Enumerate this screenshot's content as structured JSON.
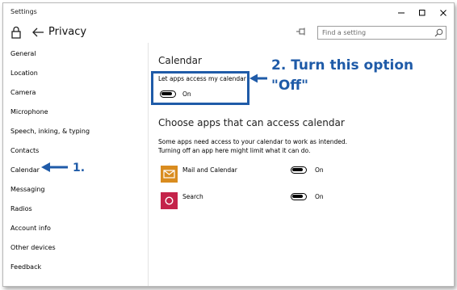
{
  "window": {
    "title": "Settings"
  },
  "header": {
    "page_title": "Privacy",
    "search_placeholder": "Find a setting"
  },
  "sidebar": {
    "items": [
      {
        "label": "General"
      },
      {
        "label": "Location"
      },
      {
        "label": "Camera"
      },
      {
        "label": "Microphone"
      },
      {
        "label": "Speech, inking, & typing"
      },
      {
        "label": "Contacts"
      },
      {
        "label": "Calendar"
      },
      {
        "label": "Messaging"
      },
      {
        "label": "Radios"
      },
      {
        "label": "Account info"
      },
      {
        "label": "Other devices"
      },
      {
        "label": "Feedback"
      }
    ],
    "selected": "Calendar"
  },
  "main": {
    "section_title": "Calendar",
    "access_label": "Let apps access my calendar",
    "access_state": "On",
    "choose_title": "Choose apps that can access calendar",
    "description_line1": "Some apps need access to your calendar to work as intended.",
    "description_line2": "Turning off an app here might limit what it can do.",
    "apps": [
      {
        "name": "Mail and Calendar",
        "state": "On",
        "icon": "mail-calendar-icon",
        "color": "#d98c1f"
      },
      {
        "name": "Search",
        "state": "On",
        "icon": "search-app-icon",
        "color": "#c4234a"
      }
    ]
  },
  "annotations": {
    "step1": "1.",
    "step2_line1": "2. Turn this option",
    "step2_line2": "\"Off\"",
    "color": "#1f5ba8"
  }
}
